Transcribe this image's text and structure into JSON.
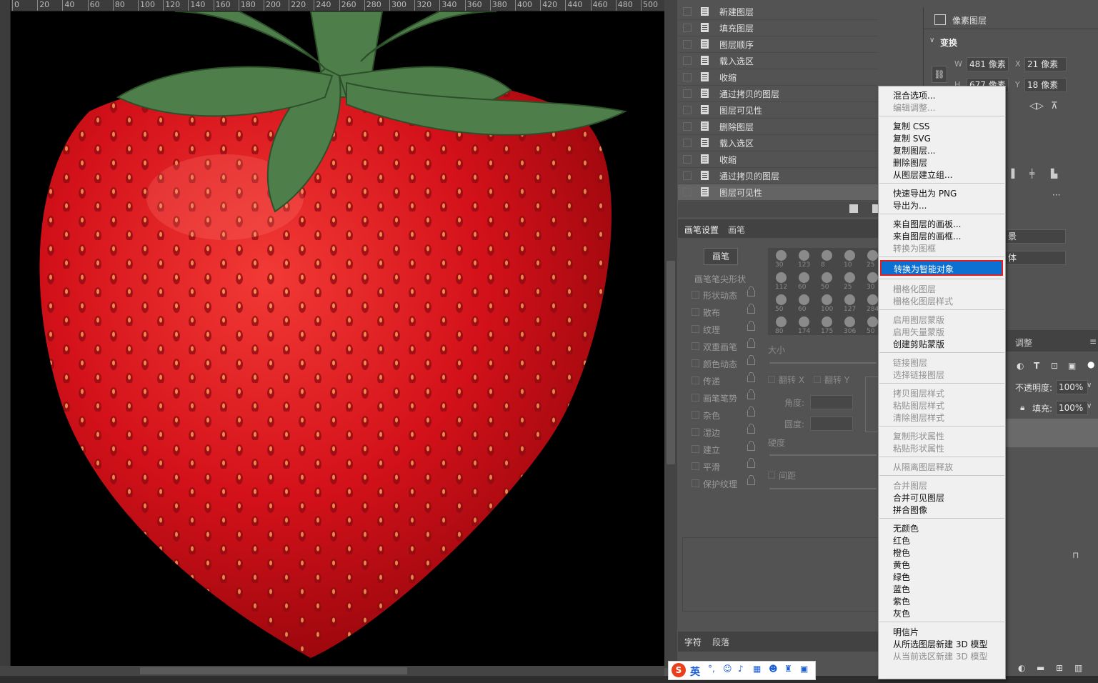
{
  "ruler": {
    "ticks": [
      "0",
      "20",
      "40",
      "60",
      "80",
      "100",
      "120",
      "140",
      "160",
      "180",
      "200",
      "220",
      "240",
      "260",
      "280",
      "300",
      "320",
      "340",
      "360",
      "380",
      "400",
      "420",
      "440",
      "460",
      "480",
      "500",
      "5"
    ]
  },
  "history": {
    "items": [
      "新建图层",
      "填充图层",
      "图层顺序",
      "载入选区",
      "收缩",
      "通过拷贝的图层",
      "图层可见性",
      "删除图层",
      "载入选区",
      "收缩",
      "通过拷贝的图层",
      "图层可见性"
    ]
  },
  "brush_panel": {
    "tabs": [
      "画笔设置",
      "画笔"
    ],
    "brush_button": "画笔",
    "tip_shape": "画笔笔尖形状",
    "options": [
      "形状动态",
      "散布",
      "纹理",
      "双重画笔",
      "颜色动态",
      "传递",
      "画笔笔势",
      "杂色",
      "湿边",
      "建立",
      "平滑",
      "保护纹理"
    ],
    "sizes": [
      "30",
      "123",
      "8",
      "10",
      "25",
      "112",
      "60",
      "50",
      "25",
      "30",
      "50",
      "60",
      "100",
      "127",
      "284",
      "80",
      "174",
      "175",
      "306",
      "50"
    ],
    "size_label": "大小",
    "flip_x": "翻转 X",
    "flip_y": "翻转 Y",
    "angle_label": "角度:",
    "roundness_label": "圆度:",
    "hardness_label": "硬度",
    "spacing_label": "间距"
  },
  "char_tabs": [
    "字符",
    "段落"
  ],
  "properties": {
    "type_label": "像素图层",
    "transform_label": "变换",
    "w_label": "W",
    "w_value": "481 像素",
    "h_label": "H",
    "h_value": "677 像素",
    "x_label": "X",
    "x_value": "21 像素",
    "y_label": "Y",
    "y_value": "18 像素",
    "partial_1": "景",
    "partial_2": "体"
  },
  "layers": {
    "tab_adjust": "调整",
    "opacity_label": "不透明度:",
    "opacity_value": "100%",
    "fill_label": "填充:",
    "fill_value": "100%"
  },
  "context_menu": {
    "groups": [
      [
        {
          "label": "混合选项...",
          "enabled": true
        },
        {
          "label": "编辑调整...",
          "enabled": false
        }
      ],
      [
        {
          "label": "复制 CSS",
          "enabled": true
        },
        {
          "label": "复制 SVG",
          "enabled": true
        },
        {
          "label": "复制图层...",
          "enabled": true
        },
        {
          "label": "删除图层",
          "enabled": true
        },
        {
          "label": "从图层建立组...",
          "enabled": true
        }
      ],
      [
        {
          "label": "快速导出为 PNG",
          "enabled": true
        },
        {
          "label": "导出为...",
          "enabled": true
        }
      ],
      [
        {
          "label": "来自图层的画板...",
          "enabled": true
        },
        {
          "label": "来自图层的画框...",
          "enabled": true
        },
        {
          "label": "转换为图框",
          "enabled": false
        }
      ],
      [
        {
          "label": "转换为智能对象",
          "enabled": true,
          "highlighted": true
        }
      ],
      [
        {
          "label": "栅格化图层",
          "enabled": false
        },
        {
          "label": "栅格化图层样式",
          "enabled": false
        }
      ],
      [
        {
          "label": "启用图层蒙版",
          "enabled": false
        },
        {
          "label": "启用矢量蒙版",
          "enabled": false
        },
        {
          "label": "创建剪贴蒙版",
          "enabled": true
        }
      ],
      [
        {
          "label": "链接图层",
          "enabled": false
        },
        {
          "label": "选择链接图层",
          "enabled": false
        }
      ],
      [
        {
          "label": "拷贝图层样式",
          "enabled": false
        },
        {
          "label": "粘贴图层样式",
          "enabled": false
        },
        {
          "label": "清除图层样式",
          "enabled": false
        }
      ],
      [
        {
          "label": "复制形状属性",
          "enabled": false
        },
        {
          "label": "粘贴形状属性",
          "enabled": false
        }
      ],
      [
        {
          "label": "从隔离图层释放",
          "enabled": false
        }
      ],
      [
        {
          "label": "合并图层",
          "enabled": false
        },
        {
          "label": "合并可见图层",
          "enabled": true
        },
        {
          "label": "拼合图像",
          "enabled": true
        }
      ],
      [
        {
          "label": "无颜色",
          "enabled": true
        },
        {
          "label": "红色",
          "enabled": true
        },
        {
          "label": "橙色",
          "enabled": true
        },
        {
          "label": "黄色",
          "enabled": true
        },
        {
          "label": "绿色",
          "enabled": true
        },
        {
          "label": "蓝色",
          "enabled": true
        },
        {
          "label": "紫色",
          "enabled": true
        },
        {
          "label": "灰色",
          "enabled": true
        }
      ],
      [
        {
          "label": "明信片",
          "enabled": true
        },
        {
          "label": "从所选图层新建 3D 模型",
          "enabled": true
        },
        {
          "label": "从当前选区新建 3D 模型",
          "enabled": false
        }
      ]
    ]
  },
  "ime": {
    "logo": "S",
    "mode": "英"
  },
  "colors": {
    "menu_highlight": "#0b70d2",
    "highlight_border": "#e02020",
    "strawberry": "#d4111a",
    "leaf": "#4e7f4a"
  }
}
